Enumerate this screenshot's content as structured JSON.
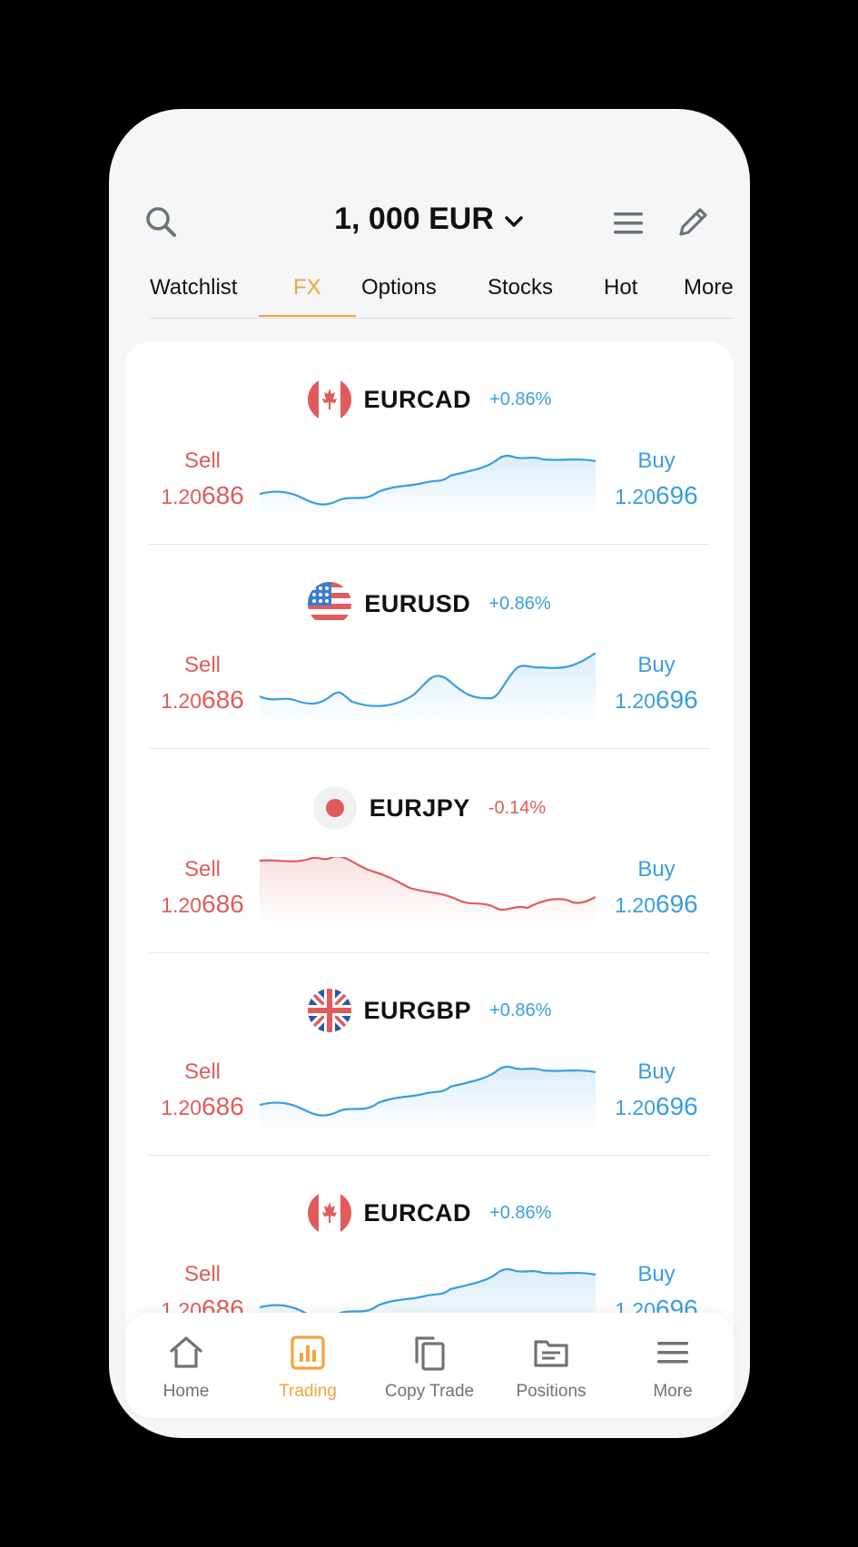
{
  "header": {
    "balance": "1, 000 EUR"
  },
  "tabs": [
    {
      "label": "Watchlist",
      "active": false
    },
    {
      "label": "FX",
      "active": true
    },
    {
      "label": "Options",
      "active": false
    },
    {
      "label": "Stocks",
      "active": false
    },
    {
      "label": "Hot",
      "active": false
    },
    {
      "label": "More",
      "active": false
    }
  ],
  "rows": [
    {
      "pair": "EURCAD",
      "flag": "canada-flag-icon",
      "change": "+0.86%",
      "direction": "up",
      "sell_label": "Sell",
      "sell_prefix": "1.20",
      "sell_big": "686",
      "buy_label": "Buy",
      "buy_prefix": "1.20",
      "buy_big": "696"
    },
    {
      "pair": "EURUSD",
      "flag": "usa-flag-icon",
      "change": "+0.86%",
      "direction": "up",
      "sell_label": "Sell",
      "sell_prefix": "1.20",
      "sell_big": "686",
      "buy_label": "Buy",
      "buy_prefix": "1.20",
      "buy_big": "696"
    },
    {
      "pair": "EURJPY",
      "flag": "japan-flag-icon",
      "change": "-0.14%",
      "direction": "down",
      "sell_label": "Sell",
      "sell_prefix": "1.20",
      "sell_big": "686",
      "buy_label": "Buy",
      "buy_prefix": "1.20",
      "buy_big": "696"
    },
    {
      "pair": "EURGBP",
      "flag": "uk-flag-icon",
      "change": "+0.86%",
      "direction": "up",
      "sell_label": "Sell",
      "sell_prefix": "1.20",
      "sell_big": "686",
      "buy_label": "Buy",
      "buy_prefix": "1.20",
      "buy_big": "696"
    },
    {
      "pair": "EURCAD",
      "flag": "canada-flag-icon",
      "change": "+0.86%",
      "direction": "up",
      "sell_label": "Sell",
      "sell_prefix": "1.20",
      "sell_big": "686",
      "buy_label": "Buy",
      "buy_prefix": "1.20",
      "buy_big": "696"
    }
  ],
  "bottom_nav": [
    {
      "label": "Home",
      "icon": "home-icon",
      "active": false
    },
    {
      "label": "Trading",
      "icon": "chart-icon",
      "active": true
    },
    {
      "label": "Copy Trade",
      "icon": "copy-icon",
      "active": false
    },
    {
      "label": "Positions",
      "icon": "folder-icon",
      "active": false
    },
    {
      "label": "More",
      "icon": "menu-icon",
      "active": false
    }
  ],
  "colors": {
    "accent": "#f5a33b",
    "up": "#3a9ee0",
    "down": "#e25b5b"
  }
}
